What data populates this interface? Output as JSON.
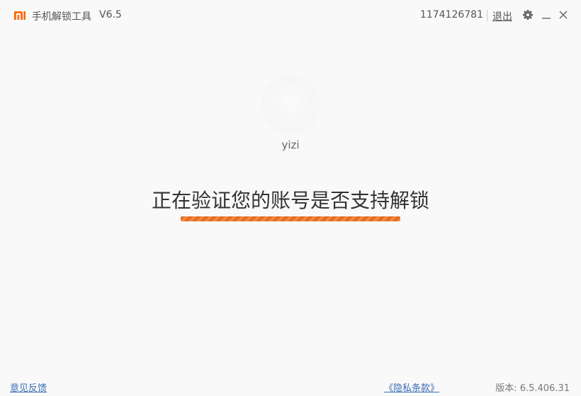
{
  "titlebar": {
    "app_title": "手机解锁工具",
    "version": "V6.5",
    "account_id": "1174126781",
    "logout_label": "退出",
    "icons": [
      "mi-logo-icon",
      "gear-icon",
      "minimize-icon",
      "close-icon"
    ]
  },
  "main": {
    "username": "yizi",
    "status_text": "正在验证您的账号是否支持解锁",
    "progress": 1.0
  },
  "footer": {
    "feedback_label": "意见反馈",
    "privacy_label": "《隐私条款》",
    "version_label": "版本: 6.5.406.31"
  },
  "colors": {
    "brand": "#ff6700",
    "progress": "#e8742e",
    "link": "#3c6fb5"
  }
}
